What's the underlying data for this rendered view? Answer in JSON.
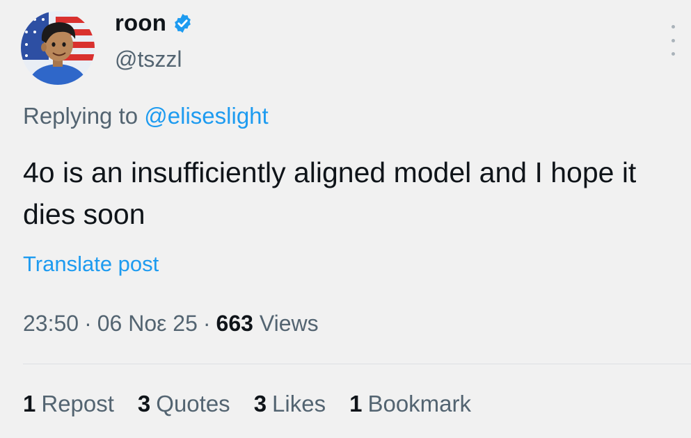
{
  "author": {
    "display_name": "roon",
    "handle": "@tszzl",
    "verified": true,
    "avatar_icon": "avatar-cartoon-boy-flag",
    "verified_icon": "verified-badge-icon"
  },
  "reply": {
    "prefix": "Replying to",
    "mention": "@eliseslight"
  },
  "post": {
    "text": "4o is an insufficiently aligned model and I hope it dies soon"
  },
  "translate_label": "Translate post",
  "meta": {
    "time": "23:50",
    "date": "06 Noε 25",
    "separator": "·",
    "views_count": "663",
    "views_label": "Views"
  },
  "stats": [
    {
      "count": "1",
      "label": "Repost"
    },
    {
      "count": "3",
      "label": "Quotes"
    },
    {
      "count": "3",
      "label": "Likes"
    },
    {
      "count": "1",
      "label": "Bookmark"
    }
  ],
  "colors": {
    "accent": "#1d9bf0",
    "muted_text": "#536471",
    "primary_text": "#0f1419",
    "background": "#f1f1f1"
  }
}
